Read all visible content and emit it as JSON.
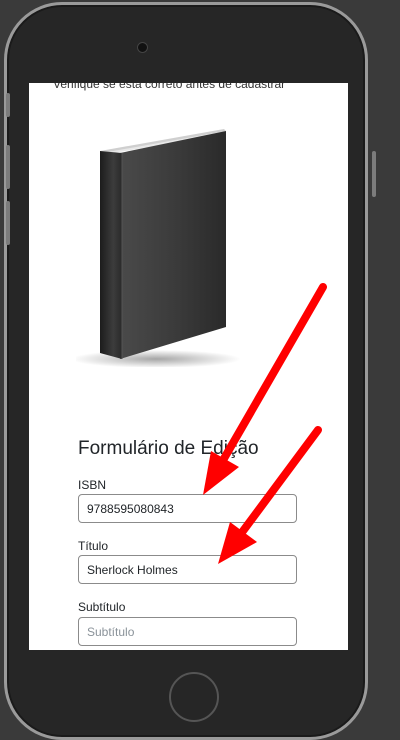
{
  "screen": {
    "hint_text": "Verifique se está correto antes de cadastrar"
  },
  "form": {
    "title": "Formulário de Edição",
    "fields": [
      {
        "label": "ISBN",
        "value": "9788595080843",
        "placeholder": ""
      },
      {
        "label": "Título",
        "value": "Sherlock Holmes",
        "placeholder": ""
      },
      {
        "label": "Subtítulo",
        "value": "",
        "placeholder": "Subtítulo"
      }
    ]
  },
  "icons": {
    "book": "book-cover-image",
    "annotation_arrow": "red-arrow-icon"
  },
  "colors": {
    "annotation": "#ff0000",
    "phone_body": "#262626",
    "background": "#3a3a3a"
  }
}
